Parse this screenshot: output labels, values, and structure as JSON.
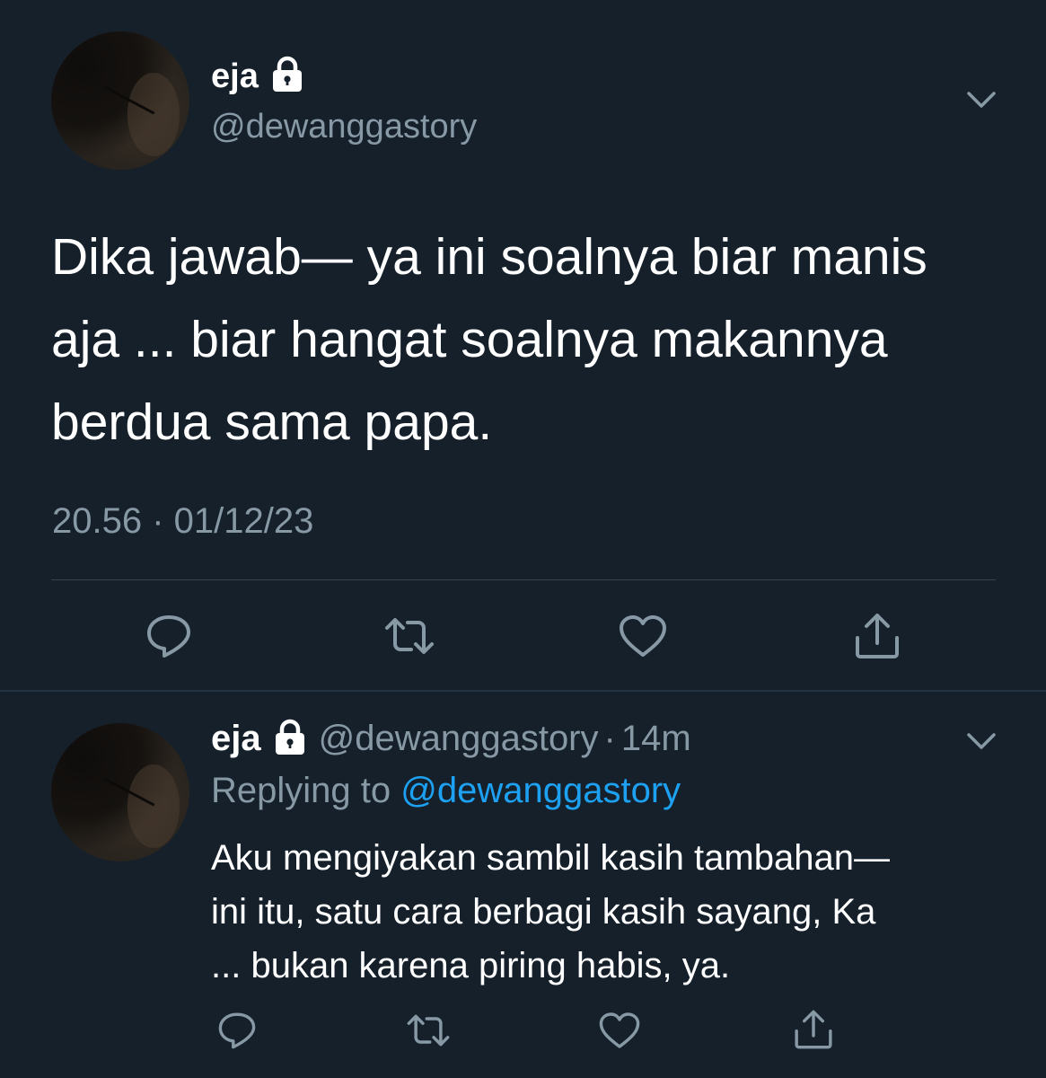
{
  "main_tweet": {
    "display_name": "eja",
    "handle": "@dewanggastory",
    "text": "Dika jawab— ya ini soalnya biar manis\naja ... biar hangat soalnya makannya\nberdua sama papa.",
    "timestamp": "20.56 · 01/12/23"
  },
  "reply_tweet": {
    "display_name": "eja",
    "handle": "@dewanggastory",
    "separator": "·",
    "time": "14m",
    "replying_prefix": "Replying to",
    "replying_handle": "@dewanggastory",
    "text": "Aku mengiyakan sambil kasih tambahan—\nini itu, satu cara berbagi kasih sayang, Ka\n... bukan karena piring habis, ya."
  },
  "icons": {
    "lock": "lock-icon",
    "menu": "chevron-down-icon",
    "reply": "reply-icon",
    "retweet": "retweet-icon",
    "like": "heart-icon",
    "share": "share-icon"
  },
  "colors": {
    "background": "#15202b",
    "text_primary": "#ffffff",
    "text_secondary": "#8899a6",
    "accent": "#1da1f2",
    "divider": "#38444d"
  }
}
